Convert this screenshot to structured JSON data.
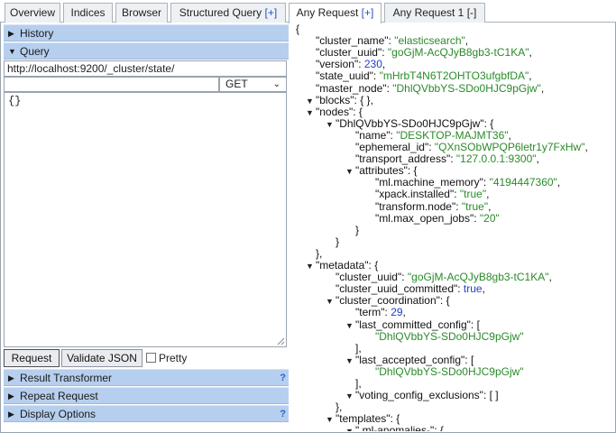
{
  "tabs": [
    {
      "label": "Overview",
      "plus": ""
    },
    {
      "label": "Indices",
      "plus": ""
    },
    {
      "label": "Browser",
      "plus": ""
    },
    {
      "label": "Structured Query ",
      "plus": "[+]"
    },
    {
      "label": "Any Request ",
      "plus": "[+]"
    },
    {
      "label": "Any Request 1 ",
      "plus": "[-]"
    }
  ],
  "left": {
    "history_label": "History",
    "query_label": "Query",
    "url_value": "http://localhost:9200/_cluster/state/",
    "method_value": "GET",
    "body_value": "{}",
    "request_button": "Request",
    "validate_button": "Validate JSON",
    "pretty_label": "Pretty",
    "result_transformer_label": "Result Transformer",
    "repeat_request_label": "Repeat Request",
    "display_options_label": "Display Options",
    "help_mark": "?"
  },
  "json_lines": [
    {
      "indent": 0,
      "toggle": "",
      "key": "",
      "value": "",
      "type": "p",
      "tail": "{"
    },
    {
      "indent": 1,
      "toggle": "",
      "key": "\"cluster_name\": ",
      "value": "\"elasticsearch\"",
      "type": "s",
      "tail": ","
    },
    {
      "indent": 1,
      "toggle": "",
      "key": "\"cluster_uuid\": ",
      "value": "\"goGjM-AcQJyB8gb3-tC1KA\"",
      "type": "s",
      "tail": ","
    },
    {
      "indent": 1,
      "toggle": "",
      "key": "\"version\": ",
      "value": "230",
      "type": "n",
      "tail": ","
    },
    {
      "indent": 1,
      "toggle": "",
      "key": "\"state_uuid\": ",
      "value": "\"mHrbT4N6T2OHTO3ufgbfDA\"",
      "type": "s",
      "tail": ","
    },
    {
      "indent": 1,
      "toggle": "",
      "key": "\"master_node\": ",
      "value": "\"DhlQVbbYS-SDo0HJC9pGjw\"",
      "type": "s",
      "tail": ","
    },
    {
      "indent": 1,
      "toggle": "▼",
      "key": "\"blocks\": ",
      "value": "{ }",
      "type": "p",
      "tail": ","
    },
    {
      "indent": 1,
      "toggle": "▼",
      "key": "\"nodes\": ",
      "value": "{",
      "type": "p",
      "tail": ""
    },
    {
      "indent": 2,
      "toggle": "▼",
      "key": "\"DhlQVbbYS-SDo0HJC9pGjw\": ",
      "value": "{",
      "type": "p",
      "tail": ""
    },
    {
      "indent": 3,
      "toggle": "",
      "key": "\"name\": ",
      "value": "\"DESKTOP-MAJMT36\"",
      "type": "s",
      "tail": ","
    },
    {
      "indent": 3,
      "toggle": "",
      "key": "\"ephemeral_id\": ",
      "value": "\"QXnSObWPQP6letr1y7FxHw\"",
      "type": "s",
      "tail": ","
    },
    {
      "indent": 3,
      "toggle": "",
      "key": "\"transport_address\": ",
      "value": "\"127.0.0.1:9300\"",
      "type": "s",
      "tail": ","
    },
    {
      "indent": 3,
      "toggle": "▼",
      "key": "\"attributes\": ",
      "value": "{",
      "type": "p",
      "tail": ""
    },
    {
      "indent": 4,
      "toggle": "",
      "key": "\"ml.machine_memory\": ",
      "value": "\"4194447360\"",
      "type": "s",
      "tail": ","
    },
    {
      "indent": 4,
      "toggle": "",
      "key": "\"xpack.installed\": ",
      "value": "\"true\"",
      "type": "s",
      "tail": ","
    },
    {
      "indent": 4,
      "toggle": "",
      "key": "\"transform.node\": ",
      "value": "\"true\"",
      "type": "s",
      "tail": ","
    },
    {
      "indent": 4,
      "toggle": "",
      "key": "\"ml.max_open_jobs\": ",
      "value": "\"20\"",
      "type": "s",
      "tail": ""
    },
    {
      "indent": 3,
      "toggle": "",
      "key": "",
      "value": "",
      "type": "p",
      "tail": "}"
    },
    {
      "indent": 2,
      "toggle": "",
      "key": "",
      "value": "",
      "type": "p",
      "tail": "}"
    },
    {
      "indent": 1,
      "toggle": "",
      "key": "",
      "value": "",
      "type": "p",
      "tail": "},"
    },
    {
      "indent": 1,
      "toggle": "▼",
      "key": "\"metadata\": ",
      "value": "{",
      "type": "p",
      "tail": ""
    },
    {
      "indent": 2,
      "toggle": "",
      "key": "\"cluster_uuid\": ",
      "value": "\"goGjM-AcQJyB8gb3-tC1KA\"",
      "type": "s",
      "tail": ","
    },
    {
      "indent": 2,
      "toggle": "",
      "key": "\"cluster_uuid_committed\": ",
      "value": "true",
      "type": "n",
      "tail": ","
    },
    {
      "indent": 2,
      "toggle": "▼",
      "key": "\"cluster_coordination\": ",
      "value": "{",
      "type": "p",
      "tail": ""
    },
    {
      "indent": 3,
      "toggle": "",
      "key": "\"term\": ",
      "value": "29",
      "type": "n",
      "tail": ","
    },
    {
      "indent": 3,
      "toggle": "▼",
      "key": "\"last_committed_config\": ",
      "value": "[",
      "type": "p",
      "tail": ""
    },
    {
      "indent": 4,
      "toggle": "",
      "key": "",
      "value": "\"DhlQVbbYS-SDo0HJC9pGjw\"",
      "type": "s",
      "tail": ""
    },
    {
      "indent": 3,
      "toggle": "",
      "key": "",
      "value": "",
      "type": "p",
      "tail": "],"
    },
    {
      "indent": 3,
      "toggle": "▼",
      "key": "\"last_accepted_config\": ",
      "value": "[",
      "type": "p",
      "tail": ""
    },
    {
      "indent": 4,
      "toggle": "",
      "key": "",
      "value": "\"DhlQVbbYS-SDo0HJC9pGjw\"",
      "type": "s",
      "tail": ""
    },
    {
      "indent": 3,
      "toggle": "",
      "key": "",
      "value": "",
      "type": "p",
      "tail": "],"
    },
    {
      "indent": 3,
      "toggle": "▼",
      "key": "\"voting_config_exclusions\": ",
      "value": "[ ]",
      "type": "p",
      "tail": ""
    },
    {
      "indent": 2,
      "toggle": "",
      "key": "",
      "value": "",
      "type": "p",
      "tail": "},"
    },
    {
      "indent": 2,
      "toggle": "▼",
      "key": "\"templates\": ",
      "value": "{",
      "type": "p",
      "tail": ""
    },
    {
      "indent": 3,
      "toggle": "▼",
      "key": "\".ml-anomalies-\": ",
      "value": "{",
      "type": "p",
      "tail": ""
    }
  ],
  "colors": {
    "accordion": "#b7cfee",
    "string": "#2a8a2a",
    "number": "#2240c0",
    "tab_plus": "#2550c8"
  }
}
